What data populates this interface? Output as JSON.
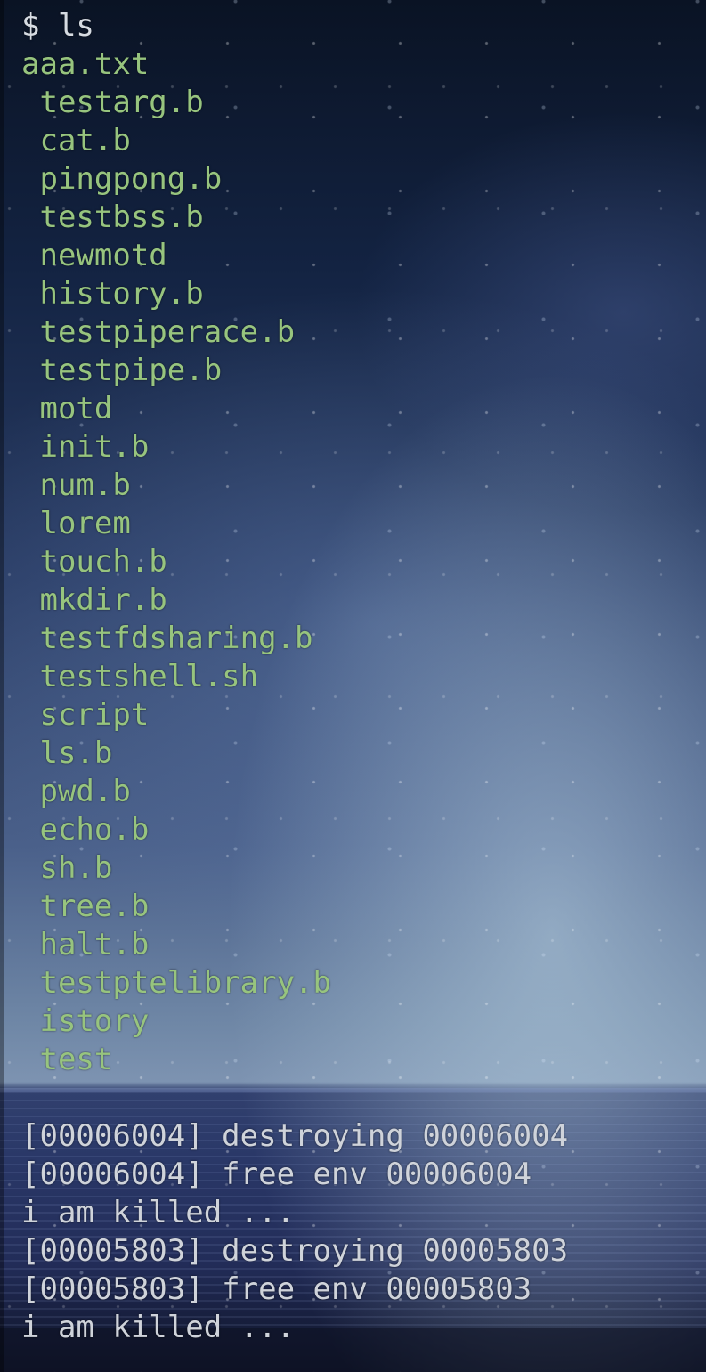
{
  "colors": {
    "prompt_text": "#d6dbe2",
    "file_text": "#97c47e",
    "log_text": "#cfd3da"
  },
  "terminal": {
    "command": "$ ls",
    "files": [
      "aaa.txt",
      " testarg.b",
      " cat.b",
      " pingpong.b",
      " testbss.b",
      " newmotd",
      " history.b",
      " testpiperace.b",
      " testpipe.b",
      " motd",
      " init.b",
      " num.b",
      " lorem",
      " touch.b",
      " mkdir.b",
      " testfdsharing.b",
      " testshell.sh",
      " script",
      " ls.b",
      " pwd.b",
      " echo.b",
      " sh.b",
      " tree.b",
      " halt.b",
      " testptelibrary.b",
      " istory",
      " test"
    ],
    "log_lines": [
      "[00006004] destroying 00006004",
      "[00006004] free env 00006004",
      "i am killed ...",
      "[00005803] destroying 00005803",
      "[00005803] free env 00005803",
      "i am killed ..."
    ]
  }
}
